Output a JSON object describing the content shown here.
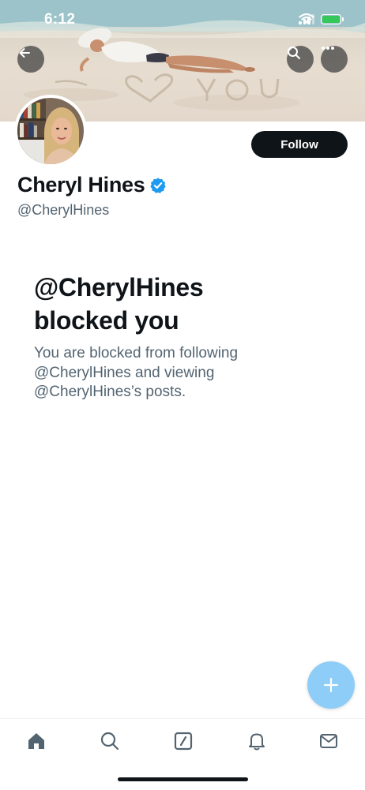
{
  "status_bar": {
    "time": "6:12"
  },
  "header": {
    "back_icon": "arrow-left-icon",
    "search_icon": "search-icon",
    "more_icon": "more-horizontal-icon"
  },
  "profile": {
    "display_name": "Cheryl Hines",
    "handle": "@CherylHines",
    "verified": true,
    "follow_label": "Follow"
  },
  "blocked": {
    "title_line1": "@CherylHines",
    "title_line2": "blocked you",
    "desc_line1": "You are blocked from following",
    "desc_line2": "@CherylHines and viewing",
    "desc_line3": "@CherylHines’s posts."
  },
  "fab": {
    "icon": "plus-icon"
  },
  "tabbar": {
    "items": [
      "home-icon",
      "search-icon",
      "grok-icon",
      "notifications-icon",
      "messages-icon"
    ]
  },
  "colors": {
    "accent": "#1d9bf0",
    "fab": "#8ecdf7",
    "text_primary": "#0f1419",
    "text_secondary": "#536471",
    "battery": "#34c759"
  }
}
